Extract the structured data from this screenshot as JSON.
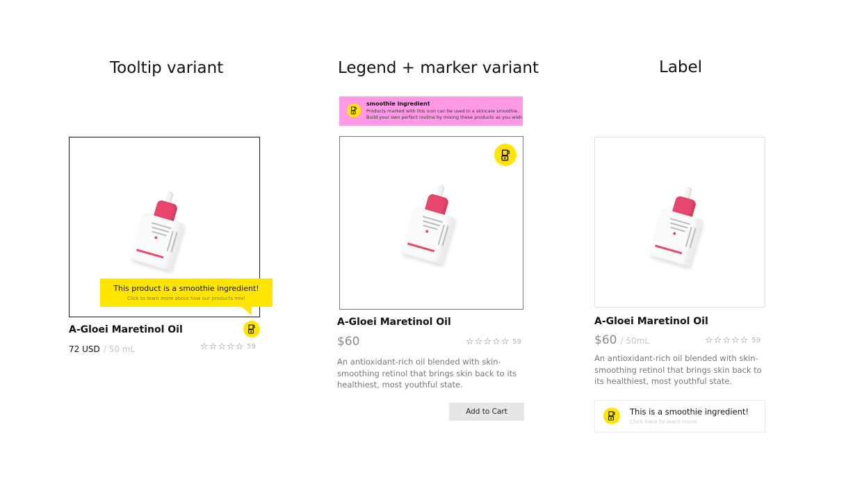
{
  "headings": {
    "tooltip": "Tooltip variant",
    "legend": "Legend + marker variant",
    "label": "Label"
  },
  "colors": {
    "badge_yellow": "#ffe500",
    "legend_pink": "#ff99e6",
    "cap_pink": "#e8466c"
  },
  "icons": {
    "smoothie": "blender-icon",
    "rating": "star-outline-icon"
  },
  "variant_tooltip": {
    "product_name": "A-Gloei Maretinol Oil",
    "price": "72 USD",
    "size": "/ 50 mL",
    "rating_count": "59",
    "tooltip_title": "This product is a smoothie ingredient!",
    "tooltip_subtitle": "Click to learn more about how our products mix!"
  },
  "variant_legend": {
    "legend_title": "smoothie ingredient",
    "legend_line1": "Products marked with this icon can be used in a skincare smoothie.",
    "legend_line2": "Build your own perfect routine by mixing these products as you wish.",
    "product_name": "A-Gloei Maretinol Oil",
    "price": "$60",
    "rating_count": "59",
    "description": "An antioxidant-rich oil blended with skin-smoothing retinol that brings skin back to its healthiest, most youthful state.",
    "add_to_cart": "Add to Cart"
  },
  "variant_label": {
    "product_name": "A-Gloei Maretinol Oil",
    "price": "$60",
    "size": "/ 50mL",
    "rating_count": "59",
    "description": "An antioxidant-rich oil blended with skin-smoothing retinol that brings skin back to its healthiest, most youthful state.",
    "label_title": "This is a smoothie ingredient!",
    "label_subtitle": "Click here to learn more"
  }
}
